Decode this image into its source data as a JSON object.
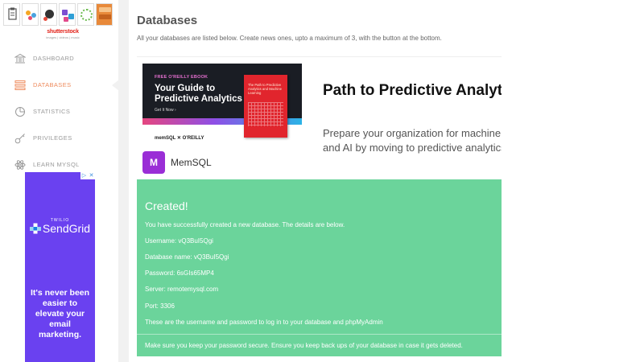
{
  "sidebar": {
    "logo": {
      "brand": "shutterstock",
      "tagline": "images | videos | music"
    },
    "items": [
      {
        "label": "DASHBOARD",
        "icon": "bank-icon",
        "active": false
      },
      {
        "label": "DATABASES",
        "icon": "database-bars-icon",
        "active": true
      },
      {
        "label": "STATISTICS",
        "icon": "pie-chart-icon",
        "active": false
      },
      {
        "label": "PRIVILEGES",
        "icon": "key-icon",
        "active": false
      },
      {
        "label": "LEARN MYSQL",
        "icon": "atom-icon",
        "active": false
      }
    ],
    "ad": {
      "brand_small": "TWILIO",
      "brand": "SendGrid",
      "copy": "It's never been easier to elevate your email marketing.",
      "background": "#6a41f0"
    }
  },
  "main": {
    "title": "Databases",
    "subtitle": "All your databases are listed below. Create news ones, upto a maximum of 3, with the button at the bottom.",
    "banner": {
      "ebook_eyebrow": "FREE O'REILLY EBOOK",
      "ebook_title": "Your Guide to Predictive Analytics",
      "ebook_cta": "Get It Now ›",
      "ebook_partners": "memSQL ✕ O'REILLY",
      "book_title": "The Path to Predictive Analytics and Machine Learning",
      "brand_logo_text": "M",
      "brand_name": "MemSQL",
      "headline": "Path to Predictive Analytics",
      "body_line1": "Prepare your organization for machine learning",
      "body_line2": "and AI by moving to predictive analytics."
    },
    "alert": {
      "heading": "Created!",
      "intro": "You have successfully created a new database. The details are below.",
      "username": "Username: vQ3BuI5Qgi",
      "database_name": "Database name: vQ3BuI5Qgi",
      "password": "Password: 6sGIs65MP4",
      "server": "Server: remotemysql.com",
      "port": "Port: 3306",
      "note": "These are the username and password to log in to your database and phpMyAdmin",
      "warning": "Make sure you keep your password secure. Ensure you keep back ups of your database in case it gets deleted.",
      "color": "#6bd49b"
    }
  },
  "colors": {
    "accent": "#ee8b5d",
    "muted": "#9a9a9a"
  }
}
